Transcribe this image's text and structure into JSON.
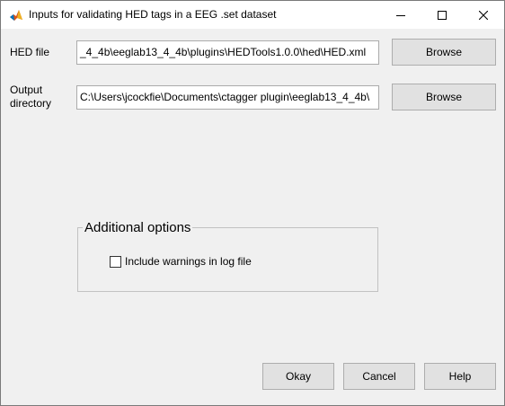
{
  "window": {
    "title": "Inputs for validating HED tags in a EEG .set dataset",
    "icons": {
      "app": "matlab-icon",
      "minimize": "minimize-icon",
      "maximize": "maximize-icon",
      "close": "close-icon"
    }
  },
  "form": {
    "hed_file": {
      "label": "HED file",
      "value": "_4_4b\\eeglab13_4_4b\\plugins\\HEDTools1.0.0\\hed\\HED.xml",
      "browse_label": "Browse"
    },
    "output_directory": {
      "label_line1": "Output",
      "label_line2": "directory",
      "value": "C:\\Users\\jcockfie\\Documents\\ctagger plugin\\eeglab13_4_4b\\",
      "browse_label": "Browse"
    }
  },
  "additional_options": {
    "title": "Additional options",
    "include_warnings": {
      "label": "Include warnings in log file",
      "checked": false
    }
  },
  "buttons": {
    "okay": "Okay",
    "cancel": "Cancel",
    "help": "Help"
  }
}
